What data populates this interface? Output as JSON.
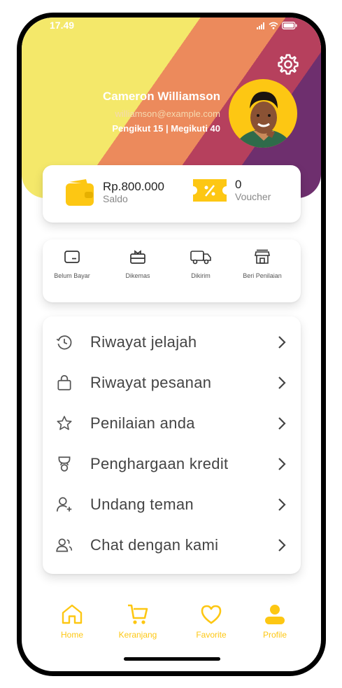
{
  "status": {
    "time": "17.49"
  },
  "profile": {
    "name": "Cameron Williamson",
    "email": "williamson@example.com",
    "follow": "Pengikut  15 | Megikuti  40"
  },
  "wallet": {
    "value": "Rp.800.000",
    "label": "Saldo"
  },
  "voucher": {
    "value": "0",
    "label": "Voucher"
  },
  "orders": [
    {
      "label": "Belum Bayar"
    },
    {
      "label": "Dikemas"
    },
    {
      "label": "Dikirim"
    },
    {
      "label": "Beri Penilaian"
    }
  ],
  "menu": [
    {
      "label": "Riwayat jelajah",
      "icon": "history-icon"
    },
    {
      "label": "Riwayat pesanan",
      "icon": "shopping-bag-icon"
    },
    {
      "label": "Penilaian anda",
      "icon": "star-icon"
    },
    {
      "label": "Penghargaan kredit",
      "icon": "trophy-icon"
    },
    {
      "label": "Undang teman",
      "icon": "add-user-icon"
    },
    {
      "label": "Chat dengan kami",
      "icon": "chat-users-icon"
    }
  ],
  "nav": [
    {
      "label": "Home",
      "icon": "home-icon"
    },
    {
      "label": "Keranjang",
      "icon": "cart-icon"
    },
    {
      "label": "Favorite",
      "icon": "heart-icon"
    },
    {
      "label": "Profile",
      "icon": "profile-icon"
    }
  ],
  "colors": {
    "accent": "#fdc713",
    "hero_yellow": "#f4e86a",
    "hero_orange": "#ec8a5c",
    "hero_red": "#b6405d",
    "hero_purple": "#6e2f6e"
  }
}
